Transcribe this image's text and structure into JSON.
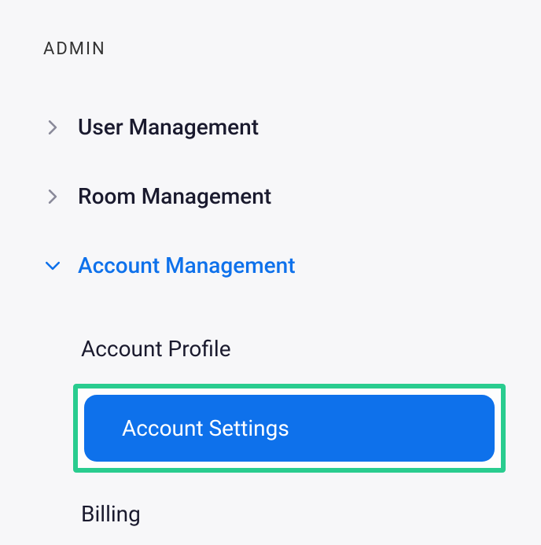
{
  "sidebar": {
    "section_header": "ADMIN",
    "items": [
      {
        "label": "User Management",
        "expanded": false
      },
      {
        "label": "Room Management",
        "expanded": false
      },
      {
        "label": "Account Management",
        "expanded": true
      }
    ],
    "sub_items": [
      {
        "label": "Account Profile",
        "active": false
      },
      {
        "label": "Account Settings",
        "active": true
      },
      {
        "label": "Billing",
        "active": false
      }
    ]
  }
}
